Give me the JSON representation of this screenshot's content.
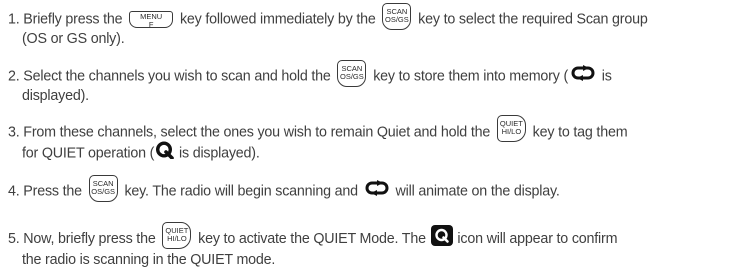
{
  "keys": {
    "menu": {
      "top": "MENU",
      "bottom": "F"
    },
    "scan": {
      "top": "SCAN",
      "bottom": "OS/GS"
    },
    "quiet": {
      "top": "QUIET",
      "bottom": "HI/LO"
    }
  },
  "icons": {
    "scan_arrows": "scan-cycle-icon",
    "quiet_outline": "quiet-q-icon",
    "quiet_box": "quiet-box-icon"
  },
  "steps": [
    {
      "a": "1. Briefly press the",
      "b": "key followed immediately by the",
      "c": "key to select the required Scan group",
      "d": "(OS or GS only)."
    },
    {
      "a": "2. Select the channels you wish to scan and hold the",
      "b": "key to store them into memory (",
      "c": "is",
      "d": "displayed)."
    },
    {
      "a": "3. From these channels, select the ones you wish to remain Quiet and hold the",
      "b": "key to tag them",
      "c": "for QUIET operation (",
      "d": "is displayed)."
    },
    {
      "a": "4. Press the",
      "b": "key. The radio will begin scanning and",
      "c": "will animate on the display."
    },
    {
      "a": "5. Now, briefly press the",
      "b": "key to activate the QUIET Mode. The",
      "c": "icon will appear to confirm",
      "d": "the radio is scanning in the QUIET mode."
    }
  ]
}
